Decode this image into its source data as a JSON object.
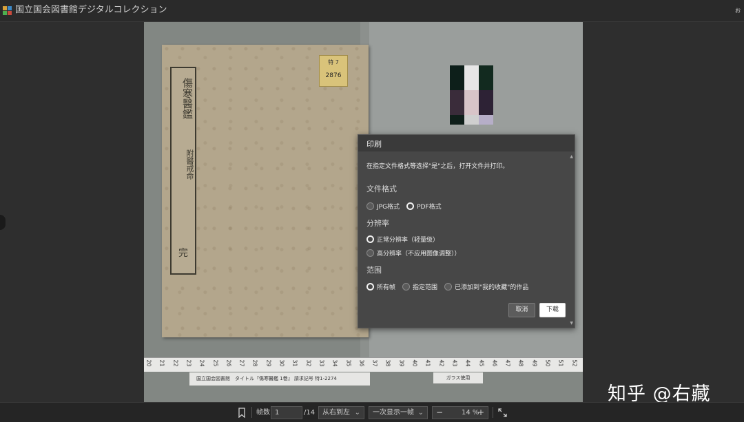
{
  "app": {
    "title": "国立国会図書館デジタルコレクション",
    "corner_mark": "ぉ",
    "left_edge_char": "0"
  },
  "scan": {
    "slip_title": "傷寒醫鑑",
    "slip_subtitle": "附醫戒命",
    "slip_bottom": "完",
    "call_label_top": "特 7",
    "call_label_number": "2876",
    "ruler_ticks": [
      "20",
      "21",
      "22",
      "23",
      "24",
      "25",
      "26",
      "27",
      "28",
      "29",
      "30",
      "31",
      "32",
      "33",
      "34",
      "35",
      "36",
      "37",
      "38",
      "39",
      "40",
      "41",
      "42",
      "43",
      "44",
      "45",
      "46",
      "47",
      "48",
      "49",
      "50",
      "51",
      "52"
    ],
    "info_strip_left": "国立国会図書館　タイトル『傷寒醫鑑 1巻』 請求記号 特1-2274",
    "info_strip_right": "ガラス使用"
  },
  "print_dialog": {
    "title": "印刷",
    "instruction": "在指定文件格式等选择\"是\"之后，打开文件并打印。",
    "format_label": "文件格式",
    "format_options": [
      {
        "label": "JPG格式",
        "checked": false
      },
      {
        "label": "PDF格式",
        "checked": true
      }
    ],
    "resolution_label": "分辨率",
    "resolution_options": [
      {
        "label": "正常分辨率（轻量级）",
        "checked": true
      },
      {
        "label": "高分辨率（不应用图像调整））",
        "checked": false
      }
    ],
    "range_label": "范围",
    "range_options": [
      {
        "label": "所有帧",
        "checked": true
      },
      {
        "label": "指定范围",
        "checked": false
      },
      {
        "label": "已添加到\"我的收藏\"的作品",
        "checked": false
      }
    ],
    "cancel_label": "取消",
    "download_label": "下载"
  },
  "watermark": "知乎 @右藏",
  "toolbar": {
    "frame_label": "帧数",
    "frame_value": "1",
    "frame_total": "/14",
    "direction_value": "从右到左",
    "display_value": "一次显示一帧",
    "zoom_value": "14 %",
    "zoom_out_symbol": "−",
    "zoom_in_symbol": "+"
  },
  "colors": {
    "dialog_bg": "#474747",
    "header_bg": "#2a2a2a",
    "toolbar_bg": "#252525",
    "book_cover": "#b3a68c",
    "swatches": [
      "#0d1f1a",
      "#e6e6e6",
      "#122a1f",
      "#3a2c3a",
      "#d8c4c8",
      "#2d2235",
      "#0f1f1a",
      "#cfcfcf",
      "#b6aec8"
    ]
  }
}
